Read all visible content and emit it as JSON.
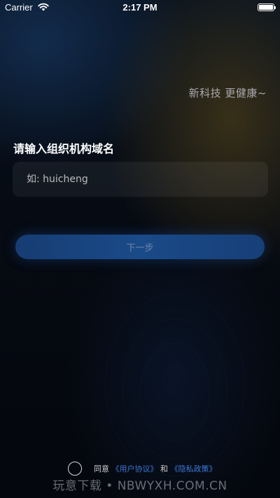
{
  "status_bar": {
    "carrier": "Carrier",
    "time": "2:17 PM",
    "icons": [
      "wifi-icon",
      "battery-icon"
    ]
  },
  "slogan": "新科技 更健康~",
  "form": {
    "label": "请输入组织机构域名",
    "input_value": "",
    "input_placeholder": "如: huicheng",
    "next_button": "下一步"
  },
  "agreement": {
    "agree_text": "同意",
    "user_agreement": "《用户协议》",
    "and_text": "和",
    "privacy_policy": "《隐私政策》",
    "checked": false
  },
  "watermark": "玩意下载 • NBWYXH.COM.CN",
  "colors": {
    "link": "#3b78d8",
    "button": "#1a4a88",
    "background": "#05080f"
  }
}
